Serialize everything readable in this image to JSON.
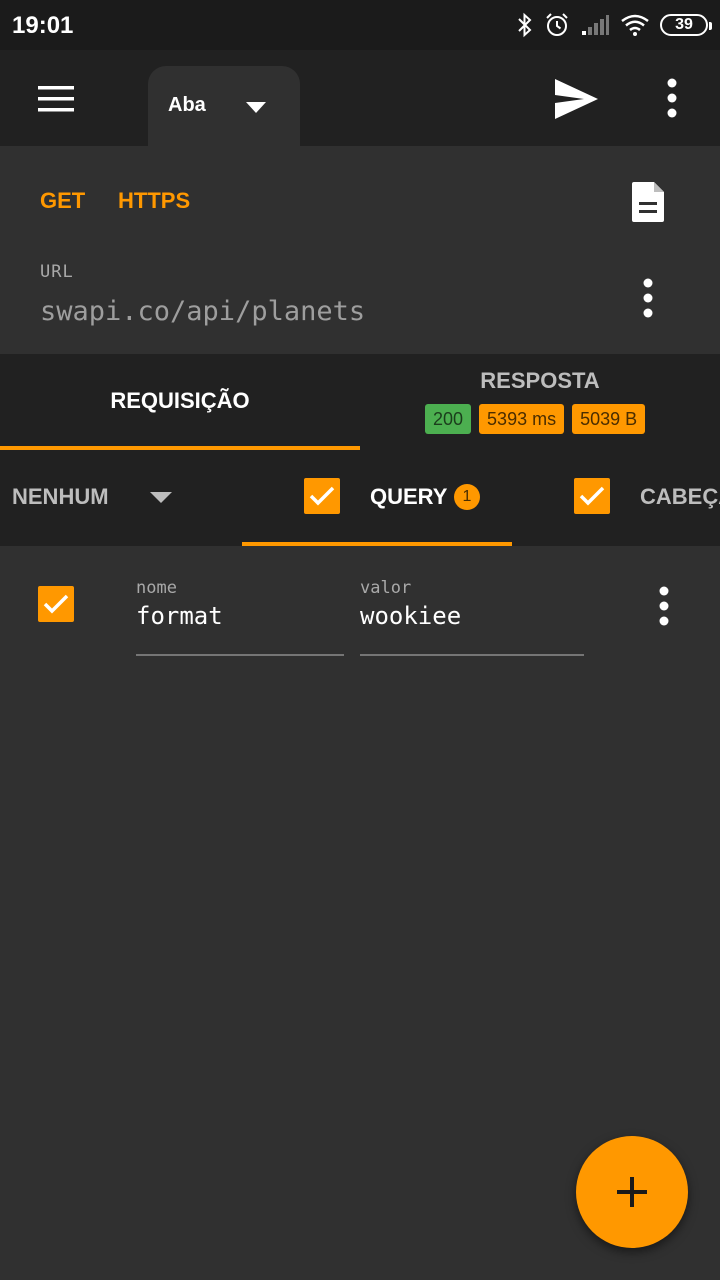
{
  "status_bar": {
    "time": "19:01",
    "battery": "39"
  },
  "app_bar": {
    "tab_name": "Aba"
  },
  "request": {
    "method": "GET",
    "scheme": "HTTPS",
    "url_label": "URL",
    "url_value": "swapi.co/api/planets"
  },
  "main_tabs": {
    "request_label": "REQUISIÇÃO",
    "response_label": "RESPOSTA",
    "status_code": "200",
    "duration": "5393 ms",
    "size": "5039 B"
  },
  "sub_tabs": {
    "auth_label": "NENHUM",
    "query_label": "QUERY",
    "query_count": "1",
    "headers_label": "CABEÇALHOS"
  },
  "params": [
    {
      "name_label": "nome",
      "name_value": "format",
      "value_label": "valor",
      "value_value": "wookiee",
      "enabled": true
    }
  ],
  "colors": {
    "accent": "#ff9800",
    "success": "#4caf50",
    "app_bar": "#212121",
    "background": "#303030"
  }
}
